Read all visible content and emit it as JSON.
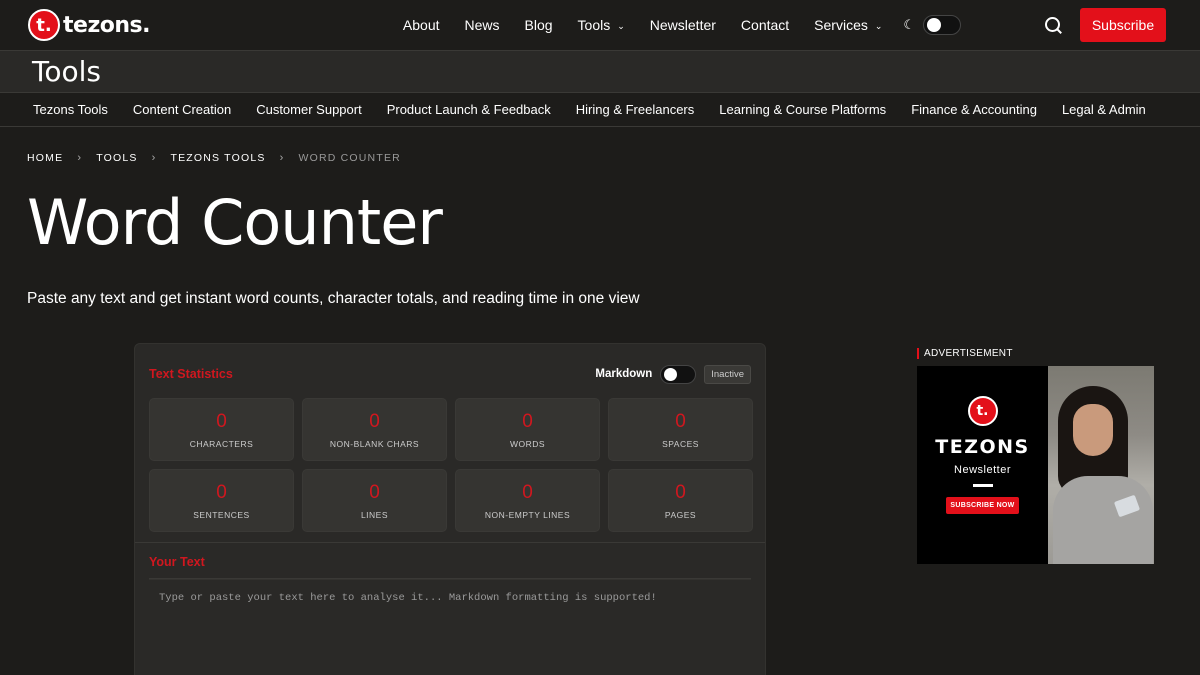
{
  "header": {
    "logo_mark": "t.",
    "logo_text": "tezons.",
    "nav": [
      "About",
      "News",
      "Blog",
      "Tools",
      "Newsletter",
      "Contact",
      "Services"
    ],
    "subscribe_label": "Subscribe"
  },
  "tools_bar": {
    "title": "Tools"
  },
  "categories": [
    "Tezons Tools",
    "Content Creation",
    "Customer Support",
    "Product Launch & Feedback",
    "Hiring & Freelancers",
    "Learning & Course Platforms",
    "Finance & Accounting",
    "Legal & Admin"
  ],
  "breadcrumb": [
    "HOME",
    "TOOLS",
    "TEZONS TOOLS",
    "WORD COUNTER"
  ],
  "page": {
    "title": "Word Counter",
    "subtitle": "Paste any text and get instant word counts, character totals, and reading time in one view"
  },
  "card": {
    "stats_label": "Text Statistics",
    "markdown_label": "Markdown",
    "markdown_status": "Inactive",
    "stats": [
      {
        "value": "0",
        "label": "CHARACTERS"
      },
      {
        "value": "0",
        "label": "NON-BLANK CHARS"
      },
      {
        "value": "0",
        "label": "WORDS"
      },
      {
        "value": "0",
        "label": "SPACES"
      },
      {
        "value": "0",
        "label": "SENTENCES"
      },
      {
        "value": "0",
        "label": "LINES"
      },
      {
        "value": "0",
        "label": "NON-EMPTY LINES"
      },
      {
        "value": "0",
        "label": "PAGES"
      }
    ],
    "text_label": "Your Text",
    "placeholder": "Type or paste your text here to analyse it... Markdown formatting is supported!"
  },
  "ad": {
    "label": "ADVERTISEMENT",
    "logo": "t.",
    "brand": "TEZONS",
    "newsletter": "Newsletter",
    "cta": "SUBSCRIBE NOW"
  }
}
